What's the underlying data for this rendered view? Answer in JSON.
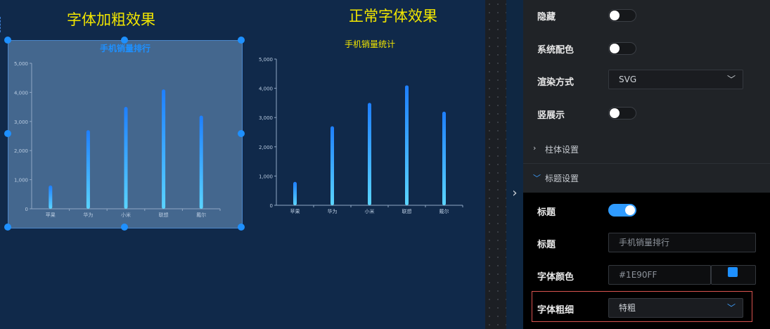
{
  "canvas": {
    "bold_demo_title": "字体加粗效果",
    "normal_demo_title": "正常字体效果"
  },
  "charts": [
    {
      "title": "手机销量排行",
      "title_color": "#1E90FF",
      "title_weight": "特粗",
      "selected": true
    },
    {
      "title": "手机销量统计",
      "title_color": "#F2E600",
      "title_weight": "normal",
      "selected": false
    }
  ],
  "chart_data": [
    {
      "type": "bar",
      "title": "手机销量排行",
      "categories": [
        "苹果",
        "华为",
        "小米",
        "联想",
        "戴尔"
      ],
      "values": [
        800,
        2700,
        3500,
        4100,
        3200
      ],
      "y_ticks": [
        "0",
        "1,000",
        "2,000",
        "3,000",
        "4,000",
        "5,000"
      ],
      "ylim": [
        0,
        5000
      ]
    },
    {
      "type": "bar",
      "title": "手机销量统计",
      "categories": [
        "苹果",
        "华为",
        "小米",
        "联想",
        "戴尔"
      ],
      "values": [
        800,
        2700,
        3500,
        4100,
        3200
      ],
      "y_ticks": [
        "0",
        "1,000",
        "2,000",
        "3,000",
        "4,000",
        "5,000"
      ],
      "ylim": [
        0,
        5000
      ]
    }
  ],
  "panel": {
    "hide_label": "隐藏",
    "system_color_label": "系统配色",
    "render_label": "渲染方式",
    "render_value": "SVG",
    "vertical_label": "竖展示",
    "bar_section": "柱体设置",
    "title_section": "标题设置",
    "title_toggle_label": "标题",
    "title_input_label": "标题",
    "title_input_placeholder": "手机销量排行",
    "font_color_label": "字体颜色",
    "font_color_value": "#1E90FF",
    "font_weight_label": "字体粗细",
    "font_weight_value": "特粗"
  },
  "toggles": {
    "hide": false,
    "system_color": false,
    "vertical": false,
    "title": true
  },
  "colors": {
    "accent": "#1E90FF",
    "demo_title": "#F2E600",
    "highlight_border": "#D9534F"
  }
}
